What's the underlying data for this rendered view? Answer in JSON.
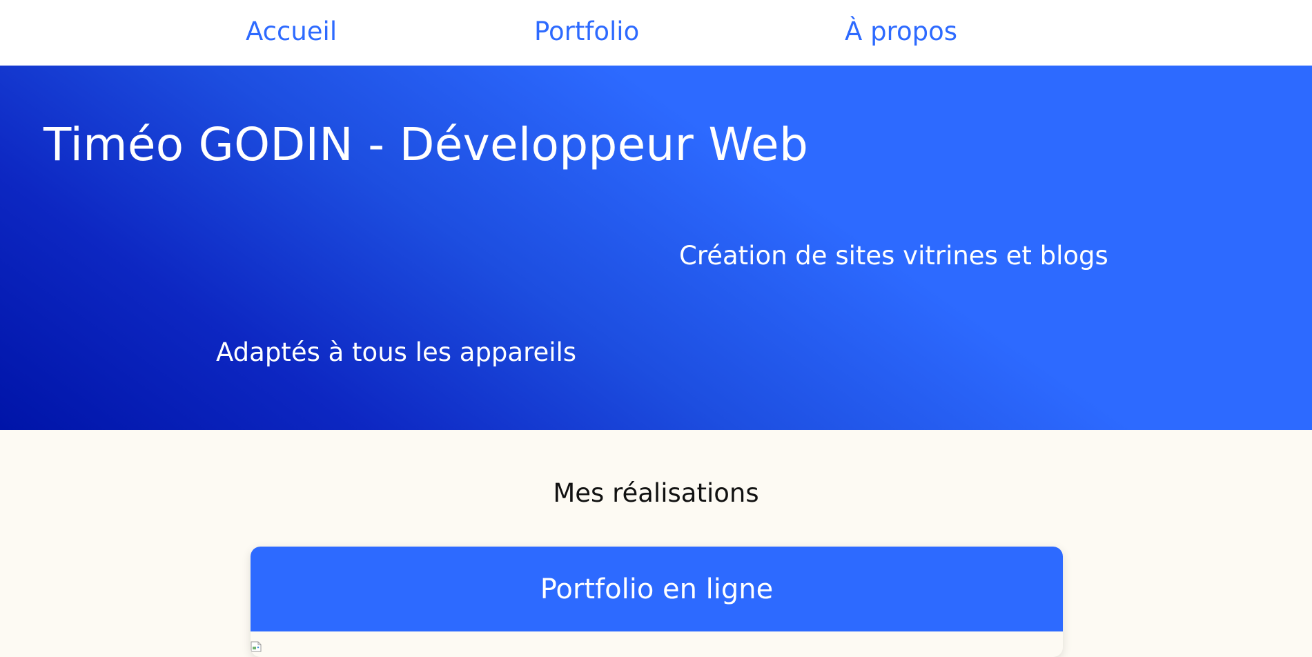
{
  "nav": {
    "items": [
      {
        "label": "Accueil"
      },
      {
        "label": "Portfolio"
      },
      {
        "label": "À propos"
      }
    ]
  },
  "hero": {
    "title": "Timéo GODIN - Développeur Web",
    "lines": [
      "Création de sites vitrines et blogs",
      "Adaptés à tous les appareils"
    ]
  },
  "projects": {
    "title": "Mes réalisations",
    "cards": [
      {
        "title": "Portfolio en ligne",
        "image_icon": "broken-image-icon"
      }
    ]
  },
  "colors": {
    "accent": "#2d6aff",
    "hero_dark": "#0014a8",
    "page_background": "#fdfaf3",
    "nav_background": "#ffffff"
  }
}
